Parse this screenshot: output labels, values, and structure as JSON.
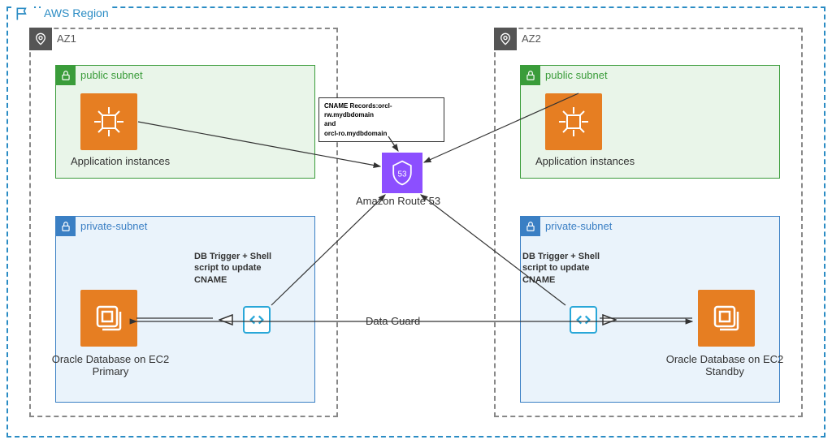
{
  "region": {
    "label": "AWS Region"
  },
  "az1": {
    "label": "AZ1"
  },
  "az2": {
    "label": "AZ2"
  },
  "public_subnet": {
    "label": "public subnet"
  },
  "private_subnet": {
    "label": "private-subnet"
  },
  "app": {
    "label": "Application instances"
  },
  "db1": {
    "label": "Oracle Database on EC2 Primary"
  },
  "db2": {
    "label": "Oracle Database on EC2 Standby"
  },
  "route53": {
    "label": "Amazon Route 53",
    "badge": "53"
  },
  "cname": {
    "line1": "CNAME Records:orcl-rw.mydbdomain",
    "line2": "and",
    "line3": "orcl-ro.mydbdomain"
  },
  "trigger": {
    "label": "DB Trigger + Shell script to update CNAME"
  },
  "dataguard": {
    "label": "Data Guard"
  }
}
